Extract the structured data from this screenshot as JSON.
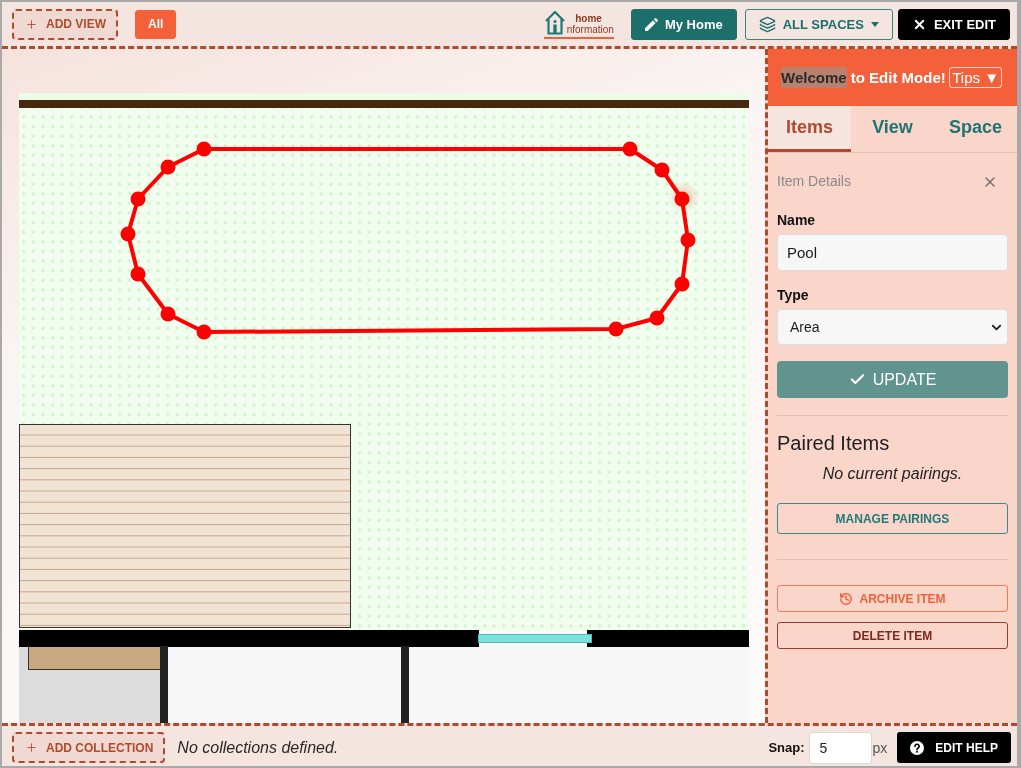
{
  "toolbar": {
    "add_view": "ADD VIEW",
    "views": [
      {
        "label": "All",
        "selected": true
      }
    ],
    "logo": {
      "top": "home",
      "bottom": "nformation"
    },
    "buttons": [
      {
        "kind": "home",
        "label": "My Home"
      },
      {
        "kind": "spaces",
        "label": "ALL SPACES"
      },
      {
        "kind": "exit",
        "label": "EXIT EDIT"
      }
    ]
  },
  "panel": {
    "title_parts": [
      {
        "text": "Welcome",
        "highlighted": true
      },
      {
        "text": "to Edit Mode!",
        "highlighted": false
      }
    ],
    "tips": "Tips ▼",
    "tabs": [
      {
        "label": "Items",
        "selected": true
      },
      {
        "label": "View",
        "selected": false
      },
      {
        "label": "Space",
        "selected": false
      }
    ],
    "section_title": "Item Details",
    "fields": [
      {
        "kind": "text",
        "label": "Name",
        "value": "Pool"
      },
      {
        "kind": "select",
        "label": "Type",
        "value": "Area"
      }
    ],
    "update_button": "UPDATE",
    "paired_items": {
      "title": "Paired Items",
      "empty_text": "No current pairings.",
      "button": "MANAGE PAIRINGS"
    },
    "actions": [
      {
        "kind": "archive",
        "label": "ARCHIVE ITEM"
      },
      {
        "kind": "delete",
        "label": "DELETE ITEM"
      }
    ]
  },
  "footer": {
    "add_collection": "ADD COLLECTION",
    "empty_text": "No collections defined.",
    "snap": {
      "label": "Snap:",
      "value": "5",
      "unit": "px"
    },
    "help_button": "EDIT HELP"
  }
}
